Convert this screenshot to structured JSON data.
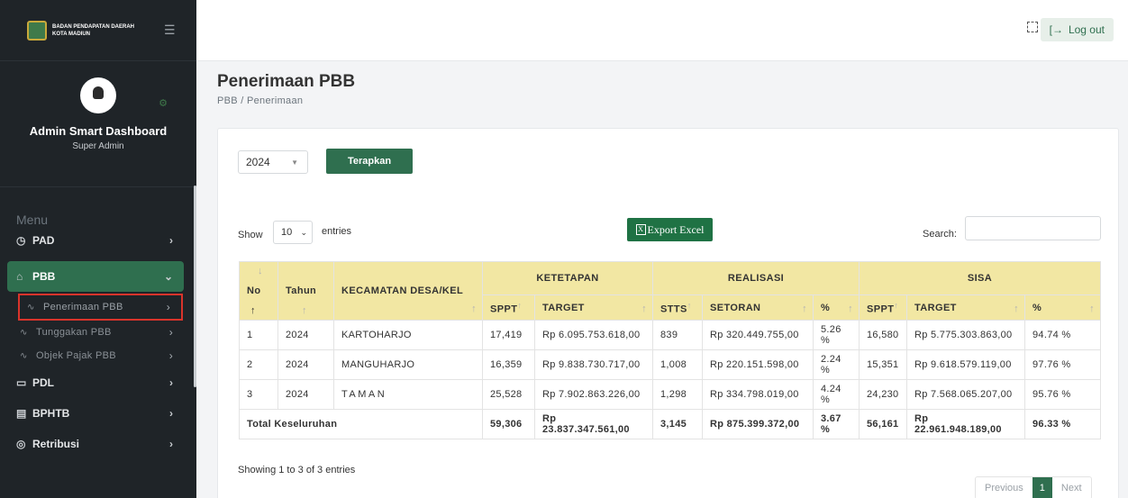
{
  "brand": {
    "name_line1": "BADAN PENDAPATAN DAERAH",
    "name_line2": "KOTA MADIUN"
  },
  "profile": {
    "name": "Admin Smart Dashboard",
    "role": "Super Admin"
  },
  "sidebar": {
    "menu_title": "Menu",
    "items": [
      {
        "label": "PAD",
        "icon": "clock-icon"
      },
      {
        "label": "PBB",
        "icon": "home-icon"
      },
      {
        "label": "PDL",
        "icon": "calendar-icon"
      },
      {
        "label": "BPHTB",
        "icon": "document-icon"
      },
      {
        "label": "Retribusi",
        "icon": "eye-icon"
      }
    ],
    "subitems": [
      {
        "label": "Penerimaan PBB"
      },
      {
        "label": "Tunggakan PBB"
      },
      {
        "label": "Objek Pajak PBB"
      }
    ]
  },
  "topbar": {
    "logout_label": "Log out"
  },
  "page": {
    "title": "Penerimaan PBB",
    "breadcrumb": "PBB / Penerimaan"
  },
  "filter": {
    "year": "2024",
    "apply_label": "Terapkan"
  },
  "table_controls": {
    "show_label": "Show",
    "length": "10",
    "entries_label": "entries",
    "export_label": "Export Excel",
    "search_label": "Search:"
  },
  "table": {
    "headers": {
      "no": "No",
      "tahun": "Tahun",
      "kecamatan": "KECAMATAN DESA/KEL",
      "ketetapan": "KETETAPAN",
      "realisasi": "REALISASI",
      "sisa": "SISA",
      "sppt": "SPPT",
      "target": "TARGET",
      "stts": "STTS",
      "setoran": "SETORAN",
      "pct": "%",
      "sppt2": "SPPT",
      "target2": "TARGET",
      "pct2": "%"
    },
    "rows": [
      {
        "no": "1",
        "tahun": "2024",
        "kec": "KARTOHARJO",
        "sppt": "17,419",
        "target": "Rp 6.095.753.618,00",
        "stts": "839",
        "setoran": "Rp 320.449.755,00",
        "pct": "5.26 %",
        "sppt2": "16,580",
        "target2": "Rp 5.775.303.863,00",
        "pct2": "94.74 %"
      },
      {
        "no": "2",
        "tahun": "2024",
        "kec": "MANGUHARJO",
        "sppt": "16,359",
        "target": "Rp 9.838.730.717,00",
        "stts": "1,008",
        "setoran": "Rp 220.151.598,00",
        "pct": "2.24 %",
        "sppt2": "15,351",
        "target2": "Rp 9.618.579.119,00",
        "pct2": "97.76 %"
      },
      {
        "no": "3",
        "tahun": "2024",
        "kec": "TAMAN",
        "sppt": "25,528",
        "target": "Rp 7.902.863.226,00",
        "stts": "1,298",
        "setoran": "Rp 334.798.019,00",
        "pct": "4.24 %",
        "sppt2": "24,230",
        "target2": "Rp 7.568.065.207,00",
        "pct2": "95.76 %"
      }
    ],
    "total": {
      "label": "Total Keseluruhan",
      "sppt": "59,306",
      "target": "Rp 23.837.347.561,00",
      "stts": "3,145",
      "setoran": "Rp 875.399.372,00",
      "pct": "3.67 %",
      "sppt2": "56,161",
      "target2": "Rp 22.961.948.189,00",
      "pct2": "96.33 %"
    }
  },
  "footer": {
    "showing": "Showing 1 to 3 of 3 entries",
    "previous": "Previous",
    "page": "1",
    "next": "Next"
  }
}
